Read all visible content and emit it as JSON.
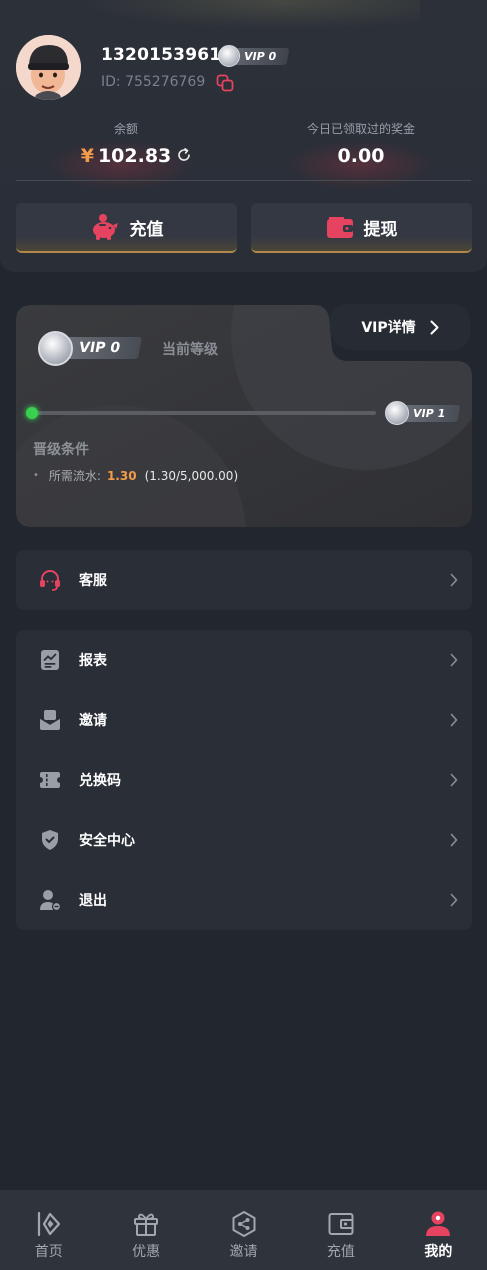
{
  "user": {
    "phone": "13201539614",
    "vip_level": "VIP 0",
    "id_text": "ID: 755276769"
  },
  "balance": {
    "label": "余额",
    "currency": "¥",
    "amount": "102.83"
  },
  "reward": {
    "label": "今日已领取过的奖金",
    "amount": "0.00"
  },
  "actions": {
    "deposit_label": "充值",
    "withdraw_label": "提现"
  },
  "vip": {
    "detail_label": "VIP详情",
    "current_badge": "VIP 0",
    "current_level_label": "当前等级",
    "next_badge": "VIP 1",
    "progress": 0.00026,
    "upgrade_title": "晋级条件",
    "requirement_label": "所需流水:",
    "requirement_value": "1.30",
    "requirement_range": "(1.30/5,000.00)"
  },
  "menu_support": [
    {
      "label": "客服",
      "icon": "headset-icon"
    }
  ],
  "menu_main": [
    {
      "label": "报表",
      "icon": "report-icon"
    },
    {
      "label": "邀请",
      "icon": "invite-icon"
    },
    {
      "label": "兑换码",
      "icon": "ticket-icon"
    },
    {
      "label": "安全中心",
      "icon": "shield-icon"
    },
    {
      "label": "退出",
      "icon": "logout-icon"
    }
  ],
  "nav": [
    {
      "label": "首页",
      "icon": "home-icon",
      "active": false
    },
    {
      "label": "优惠",
      "icon": "gift-icon",
      "active": false
    },
    {
      "label": "邀请",
      "icon": "share-icon",
      "active": false
    },
    {
      "label": "充值",
      "icon": "wallet-icon",
      "active": false
    },
    {
      "label": "我的",
      "icon": "profile-icon",
      "active": true
    }
  ],
  "colors": {
    "accent_red": "#e5435f",
    "accent_orange": "#f39b4a",
    "progress_green": "#39d353",
    "background": "#22262e",
    "card": "#2a2e36"
  }
}
